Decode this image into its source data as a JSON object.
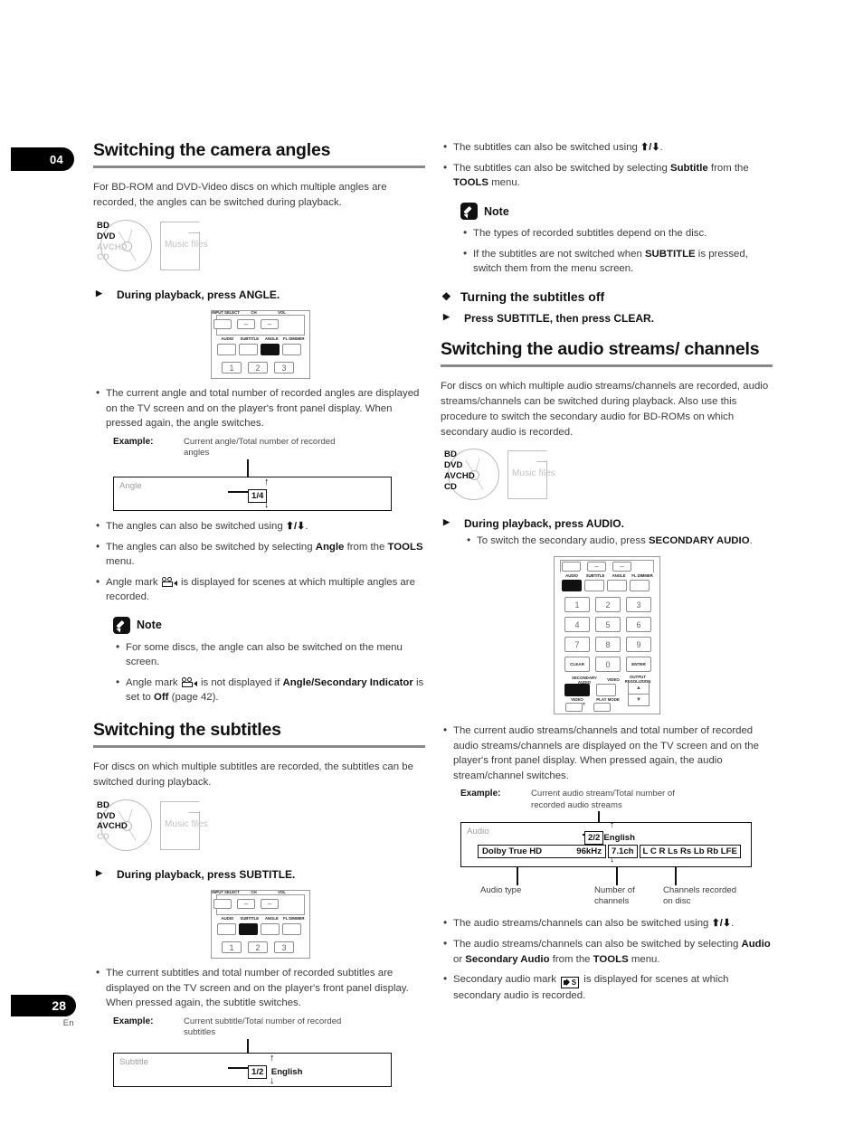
{
  "page": {
    "chapter": "04",
    "number": "28",
    "language": "En"
  },
  "left_column": {
    "section1": {
      "title": "Switching the camera angles",
      "intro": "For BD-ROM and DVD-Video discs on which multiple angles are recorded, the angles can be switched during playback.",
      "media": {
        "disc_labels": [
          "BD",
          "DVD",
          "AVCHD",
          "CD"
        ],
        "disc_enabled": [
          "BD",
          "DVD"
        ],
        "file_label": "Music files",
        "file_enabled": false
      },
      "step": "During playback, press ANGLE.",
      "remote": {
        "top_labels": [
          "INPUT SELECT",
          "CH",
          "VOL"
        ],
        "row_labels": [
          "AUDIO",
          "SUBTITLE",
          "ANGLE",
          "FL DIMMER"
        ],
        "highlighted": "ANGLE",
        "number_row": [
          "1",
          "2",
          "3"
        ]
      },
      "bullets": [
        "The current angle and total number of recorded angles are displayed on the TV screen and on the player's front panel display. When pressed again, the angle switches."
      ],
      "example": {
        "label": "Example:",
        "caption": "Current angle/Total number of recorded angles",
        "display_title": "Angle",
        "chip": "1/4",
        "suffix": ""
      },
      "bullets_after": [
        "The angles can also be switched using ↑/↓.",
        "The angles can also be switched by selecting Angle from the TOOLS menu.",
        "Angle mark is displayed for scenes at which multiple angles are recorded."
      ],
      "note": {
        "title": "Note",
        "items": [
          "For some discs, the angle can also be switched on the menu screen.",
          "Angle mark is not displayed if Angle/Secondary Indicator is set to Off (page 42)."
        ]
      }
    },
    "section2": {
      "title": "Switching the subtitles",
      "intro": "For discs on which multiple subtitles are recorded, the subtitles can be switched during playback.",
      "media": {
        "disc_labels": [
          "BD",
          "DVD",
          "AVCHD",
          "CD"
        ],
        "disc_enabled": [
          "BD",
          "DVD",
          "AVCHD"
        ],
        "file_label": "Music files",
        "file_enabled": false
      },
      "step": "During playback, press SUBTITLE.",
      "remote": {
        "top_labels": [
          "INPUT SELECT",
          "CH",
          "VOL"
        ],
        "row_labels": [
          "AUDIO",
          "SUBTITLE",
          "ANGLE",
          "FL DIMMER"
        ],
        "highlighted": "SUBTITLE",
        "number_row": [
          "1",
          "2",
          "3"
        ]
      },
      "bullets": [
        "The current subtitles and total number of recorded subtitles are displayed on the TV screen and on the player's front panel display. When pressed again, the subtitle switches."
      ],
      "example": {
        "label": "Example:",
        "caption": "Current subtitle/Total number of recorded subtitles",
        "display_title": "Subtitle",
        "chip": "1/2",
        "suffix": "English"
      }
    }
  },
  "right_column": {
    "subtitle_continued": {
      "bullets": [
        "The subtitles can also be switched using ↑/↓.",
        "The subtitles can also be switched by selecting Subtitle from the TOOLS menu."
      ],
      "note": {
        "title": "Note",
        "items": [
          "The types of recorded subtitles depend on the disc.",
          "If the subtitles are not switched when SUBTITLE is pressed, switch them from the menu screen."
        ]
      },
      "subheading": "Turning the subtitles off",
      "step": "Press SUBTITLE, then press CLEAR."
    },
    "section3": {
      "title": "Switching the audio streams/ channels",
      "intro": "For discs on which multiple audio streams/channels are recorded, audio streams/channels can be switched during playback. Also use this procedure to switch the secondary audio for BD-ROMs on which secondary audio is recorded.",
      "media": {
        "disc_labels": [
          "BD",
          "DVD",
          "AVCHD",
          "CD"
        ],
        "disc_enabled": [
          "BD",
          "DVD",
          "AVCHD",
          "CD"
        ],
        "file_label": "Music files",
        "file_enabled": false
      },
      "step": "During playback, press AUDIO.",
      "step_sub": "To switch the secondary audio, press SECONDARY AUDIO.",
      "remote": {
        "row_labels": [
          "AUDIO",
          "SUBTITLE",
          "ANGLE",
          "FL DIMMER"
        ],
        "highlighted": "AUDIO",
        "keypad": [
          "1",
          "2",
          "3",
          "4",
          "5",
          "6",
          "7",
          "8",
          "9",
          "CLEAR",
          "0",
          "ENTER"
        ],
        "bottom_labels": [
          "SECONDARY",
          "AUDIO",
          "VIDEO",
          "OUTPUT RESOLUTION",
          "VIDEO SELECT",
          "PLAY MODE"
        ],
        "secondary_highlighted": true
      },
      "bullets": [
        "The current audio streams/channels and total number of recorded audio streams/channels are displayed on the TV screen and on the player's front panel display. When pressed again, the audio stream/channel switches."
      ],
      "example": {
        "label": "Example:",
        "caption": "Current audio stream/Total number of recorded audio streams",
        "display_title": "Audio",
        "chip": "2/2",
        "language": "English",
        "audio_type": "Dolby True HD",
        "sample_rate": "96kHz",
        "channels": "7.1ch",
        "channel_list": "L C R Ls Rs Lb Rb LFE",
        "caption_audio_type": "Audio type",
        "caption_num_channels": "Number of channels",
        "caption_channels_recorded": "Channels recorded on disc"
      },
      "bullets_after": [
        "The audio streams/channels can also be switched using ↑/↓.",
        "The audio streams/channels can also be switched by selecting Audio or Secondary Audio from the TOOLS menu.",
        "Secondary audio mark is displayed for scenes at which secondary audio is recorded."
      ]
    }
  }
}
